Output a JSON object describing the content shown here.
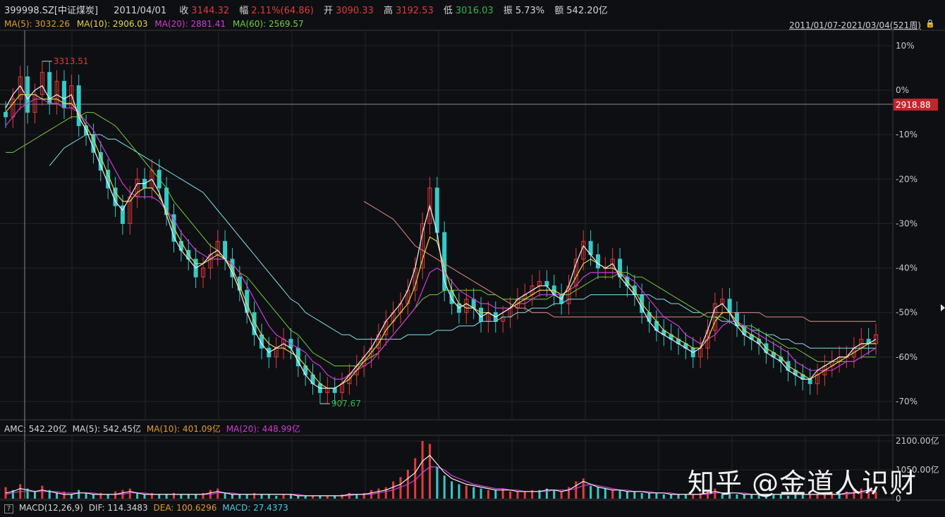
{
  "header": {
    "code": "399998.SZ[中证煤炭]",
    "date": "2011/04/01",
    "close_label": "收",
    "close": "3144.32",
    "change_label": "幅",
    "change": "2.11%(64.86)",
    "open_label": "开",
    "open": "3090.33",
    "high_label": "高",
    "high": "3192.53",
    "low_label": "低",
    "low": "3016.03",
    "amp_label": "振",
    "amp": "5.73%",
    "amount_label": "额",
    "amount": "542.20亿"
  },
  "ma_row": {
    "ma5": "MA(5): 3032.26",
    "ma10": "MA(10): 2906.03",
    "ma20": "MA(20): 2881.41",
    "ma60": "MA(60): 2569.57",
    "range": "2011/01/07-2021/03/04(521周)"
  },
  "amc_row": {
    "amc": "AMC: 542.20亿",
    "ma5": "MA(5): 542.45亿",
    "ma10": "MA(10): 401.09亿",
    "ma20": "MA(20): 448.99亿"
  },
  "macd_row": {
    "q": "?",
    "macd": "MACD(12,26,9)",
    "dif": "DIF: 114.3483",
    "dea": "DEA: 100.6296",
    "macdv": "MACD: 27.4373"
  },
  "watermark": "知乎 @金道人识财",
  "colors": {
    "up": "#e33b3b",
    "down": "#37c9c9",
    "ma5": "#f0f0f0",
    "ma10": "#e8d34a",
    "ma20": "#d23ad8",
    "ma60": "#6fcf3a",
    "ma120": "#7fe3ee",
    "ma250": "#e88a8a"
  },
  "chart_data": {
    "type": "line",
    "price_axis": {
      "ticks": [
        "10%",
        "0%",
        "-10%",
        "-20%",
        "-30%",
        "-40%",
        "-50%",
        "-60%",
        "-70%"
      ],
      "tick_values": [
        10,
        0,
        -10,
        -20,
        -30,
        -40,
        -50,
        -60,
        -70
      ],
      "current_label": "2918.88",
      "current_pct": -1.5,
      "high_label": "3313.51",
      "low_label": "907.67"
    },
    "volume_axis": {
      "ticks": [
        "2100.00亿",
        "1050.00亿",
        "0"
      ],
      "tick_values": [
        2100,
        1050,
        0
      ]
    },
    "close_pct": [
      -6,
      -2,
      3,
      -5,
      -1,
      4,
      -3,
      2,
      -4,
      1,
      -8,
      -10,
      -14,
      -18,
      -22,
      -26,
      -30,
      -24,
      -20,
      -22,
      -18,
      -22,
      -28,
      -34,
      -36,
      -38,
      -42,
      -40,
      -37,
      -34,
      -38,
      -42,
      -45,
      -50,
      -55,
      -58,
      -60,
      -58,
      -56,
      -58,
      -62,
      -64,
      -66,
      -68,
      -67,
      -68,
      -66,
      -64,
      -62,
      -60,
      -58,
      -55,
      -52,
      -50,
      -48,
      -45,
      -40,
      -30,
      -22,
      -32,
      -45,
      -48,
      -50,
      -47,
      -49,
      -52,
      -50,
      -52,
      -51,
      -49,
      -47,
      -46,
      -44,
      -43,
      -44,
      -46,
      -48,
      -44,
      -38,
      -34,
      -37,
      -40,
      -40,
      -38,
      -42,
      -44,
      -46,
      -50,
      -52,
      -54,
      -55,
      -56,
      -57,
      -58,
      -60,
      -58,
      -54,
      -48,
      -47,
      -50,
      -53,
      -55,
      -56,
      -57,
      -59,
      -60,
      -61,
      -63,
      -64,
      -65,
      -66,
      -64,
      -62,
      -61,
      -60,
      -60,
      -58,
      -56,
      -57,
      -55
    ],
    "series_pct": {
      "ma5": [
        -4,
        -1,
        1,
        -2,
        0,
        1,
        -2,
        -1,
        -2,
        -1,
        -6,
        -9,
        -13,
        -17,
        -21,
        -25,
        -27,
        -24,
        -21,
        -21,
        -20,
        -23,
        -28,
        -33,
        -36,
        -38,
        -40,
        -39,
        -37,
        -36,
        -38,
        -41,
        -45,
        -50,
        -54,
        -57,
        -59,
        -58,
        -57,
        -58,
        -61,
        -64,
        -66,
        -67,
        -67,
        -67,
        -66,
        -64,
        -62,
        -60,
        -58,
        -55,
        -52,
        -50,
        -48,
        -45,
        -40,
        -32,
        -26,
        -32,
        -43,
        -47,
        -49,
        -48,
        -49,
        -51,
        -50,
        -51,
        -50,
        -49,
        -47,
        -46,
        -45,
        -44,
        -44,
        -46,
        -47,
        -44,
        -39,
        -35,
        -37,
        -39,
        -40,
        -39,
        -42,
        -44,
        -46,
        -49,
        -52,
        -54,
        -55,
        -56,
        -57,
        -58,
        -59,
        -58,
        -54,
        -49,
        -48,
        -50,
        -53,
        -55,
        -56,
        -57,
        -59,
        -60,
        -61,
        -63,
        -64,
        -65,
        -65,
        -63,
        -62,
        -61,
        -60,
        -60,
        -58,
        -57,
        -57,
        -56
      ],
      "ma10": [
        -5,
        -3,
        -1,
        -1,
        -1,
        -2,
        -2,
        -2,
        -3,
        -3,
        -5,
        -8,
        -11,
        -15,
        -19,
        -23,
        -25,
        -25,
        -23,
        -22,
        -22,
        -24,
        -27,
        -31,
        -34,
        -37,
        -39,
        -39,
        -38,
        -37,
        -38,
        -40,
        -44,
        -48,
        -52,
        -55,
        -57,
        -58,
        -58,
        -59,
        -60,
        -62,
        -64,
        -66,
        -67,
        -67,
        -66,
        -65,
        -63,
        -61,
        -59,
        -57,
        -54,
        -52,
        -50,
        -48,
        -44,
        -38,
        -33,
        -34,
        -40,
        -45,
        -48,
        -49,
        -49,
        -50,
        -50,
        -51,
        -50,
        -49,
        -48,
        -47,
        -46,
        -45,
        -45,
        -45,
        -46,
        -45,
        -42,
        -39,
        -38,
        -39,
        -40,
        -40,
        -41,
        -43,
        -45,
        -48,
        -50,
        -52,
        -54,
        -55,
        -56,
        -57,
        -58,
        -58,
        -56,
        -52,
        -50,
        -50,
        -52,
        -54,
        -55,
        -56,
        -58,
        -59,
        -60,
        -62,
        -63,
        -64,
        -65,
        -64,
        -63,
        -62,
        -61,
        -60,
        -59,
        -58,
        -57,
        -57
      ],
      "ma20": [
        -8,
        -6,
        -4,
        -3,
        -2,
        -2,
        -3,
        -3,
        -4,
        -4,
        -5,
        -7,
        -9,
        -12,
        -15,
        -18,
        -21,
        -23,
        -24,
        -24,
        -24,
        -25,
        -27,
        -29,
        -32,
        -34,
        -36,
        -37,
        -38,
        -38,
        -38,
        -39,
        -41,
        -44,
        -47,
        -50,
        -53,
        -55,
        -56,
        -57,
        -58,
        -59,
        -61,
        -62,
        -64,
        -65,
        -65,
        -64,
        -63,
        -62,
        -61,
        -59,
        -57,
        -55,
        -53,
        -51,
        -49,
        -45,
        -41,
        -40,
        -41,
        -43,
        -45,
        -46,
        -47,
        -48,
        -48,
        -49,
        -49,
        -49,
        -48,
        -48,
        -47,
        -46,
        -46,
        -46,
        -46,
        -45,
        -44,
        -42,
        -41,
        -41,
        -41,
        -41,
        -41,
        -42,
        -43,
        -45,
        -47,
        -49,
        -51,
        -52,
        -53,
        -55,
        -56,
        -57,
        -56,
        -55,
        -53,
        -52,
        -52,
        -53,
        -54,
        -55,
        -56,
        -57,
        -58,
        -59,
        -61,
        -62,
        -63,
        -63,
        -63,
        -63,
        -62,
        -61,
        -61,
        -60,
        -59,
        -58
      ],
      "ma60": [
        -14,
        -14,
        -13,
        -12,
        -11,
        -10,
        -9,
        -8,
        -7,
        -6,
        -6,
        -5,
        -5,
        -6,
        -7,
        -8,
        -10,
        -12,
        -14,
        -16,
        -18,
        -20,
        -22,
        -25,
        -27,
        -29,
        -31,
        -33,
        -35,
        -36,
        -38,
        -39,
        -41,
        -42,
        -44,
        -46,
        -48,
        -50,
        -52,
        -54,
        -55,
        -57,
        -59,
        -60,
        -61,
        -62,
        -62,
        -62,
        -62,
        -61,
        -60,
        -59,
        -57,
        -55,
        -53,
        -51,
        -49,
        -47,
        -46,
        -46,
        -45,
        -45,
        -45,
        -45,
        -45,
        -45,
        -46,
        -46,
        -47,
        -47,
        -47,
        -47,
        -47,
        -47,
        -47,
        -46,
        -46,
        -46,
        -45,
        -44,
        -43,
        -42,
        -42,
        -42,
        -41,
        -41,
        -42,
        -42,
        -43,
        -44,
        -45,
        -46,
        -47,
        -48,
        -49,
        -50,
        -51,
        -51,
        -51,
        -52,
        -52,
        -53,
        -53,
        -54,
        -55,
        -56,
        -57,
        -58,
        -58,
        -59,
        -60,
        -61,
        -61,
        -61,
        -61,
        -61,
        -61,
        -60,
        -60,
        -60
      ],
      "ma120": [
        null,
        null,
        null,
        null,
        null,
        null,
        -17,
        -15,
        -13,
        -12,
        -11,
        -10,
        -10,
        -10,
        -11,
        -11,
        -12,
        -13,
        -14,
        -15,
        -16,
        -17,
        -18,
        -19,
        -20,
        -21,
        -22,
        -23,
        -25,
        -27,
        -29,
        -31,
        -33,
        -35,
        -37,
        -39,
        -41,
        -43,
        -45,
        -47,
        -48,
        -50,
        -51,
        -52,
        -53,
        -54,
        -55,
        -55,
        -56,
        -56,
        -56,
        -56,
        -56,
        -56,
        -56,
        -55,
        -55,
        -55,
        -55,
        -54,
        -54,
        -54,
        -53,
        -53,
        -53,
        -52,
        -52,
        -52,
        -51,
        -51,
        -50,
        -50,
        -49,
        -49,
        -49,
        -48,
        -48,
        -47,
        -47,
        -47,
        -46,
        -46,
        -46,
        -46,
        -46,
        -46,
        -46,
        -46,
        -46,
        -47,
        -47,
        -48,
        -48,
        -49,
        -50,
        -50,
        -51,
        -51,
        -52,
        -52,
        -53,
        -53,
        -54,
        -54,
        -55,
        -55,
        -56,
        -56,
        -57,
        -57,
        -58,
        -58,
        -58,
        -58,
        -58,
        -58,
        -58,
        -58,
        -58,
        -58
      ],
      "ma250": [
        null,
        null,
        null,
        null,
        null,
        null,
        null,
        null,
        null,
        null,
        null,
        null,
        null,
        null,
        null,
        null,
        null,
        null,
        null,
        null,
        null,
        null,
        null,
        null,
        null,
        null,
        null,
        null,
        null,
        null,
        null,
        null,
        null,
        null,
        null,
        null,
        null,
        null,
        null,
        null,
        null,
        null,
        null,
        null,
        null,
        null,
        null,
        null,
        null,
        -25,
        -26,
        -27,
        -28,
        -29,
        -31,
        -33,
        -35,
        -36,
        -37,
        -38,
        -39,
        -40,
        -41,
        -42,
        -43,
        -44,
        -45,
        -46,
        -47,
        -48,
        -49,
        -49,
        -50,
        -50,
        -50,
        -51,
        -51,
        -51,
        -51,
        -51,
        -51,
        -51,
        -51,
        -51,
        -51,
        -51,
        -51,
        -51,
        -51,
        -51,
        -51,
        -51,
        -51,
        -51,
        -51,
        -51,
        -50,
        -50,
        -50,
        -50,
        -50,
        -50,
        -50,
        -50,
        -51,
        -51,
        -51,
        -51,
        -51,
        -51,
        -52,
        -52,
        -52,
        -52,
        -52,
        -52,
        -52,
        -52,
        -52,
        -52
      ],
      "vol_ma5": [
        4,
        5,
        7,
        6,
        5,
        6,
        5,
        4,
        3,
        3,
        4,
        4,
        3,
        3,
        3,
        3,
        4,
        5,
        4,
        3,
        3,
        3,
        3,
        3,
        3,
        3,
        3,
        3,
        4,
        5,
        4,
        3,
        3,
        3,
        3,
        3,
        3,
        3,
        3,
        3,
        2,
        2,
        2,
        2,
        2,
        2,
        2,
        3,
        3,
        3,
        4,
        5,
        6,
        8,
        10,
        14,
        18,
        26,
        30,
        24,
        18,
        14,
        12,
        10,
        9,
        8,
        7,
        6,
        6,
        6,
        5,
        5,
        5,
        5,
        6,
        6,
        5,
        6,
        9,
        12,
        10,
        8,
        7,
        6,
        6,
        5,
        5,
        5,
        4,
        4,
        4,
        3,
        3,
        3,
        3,
        3,
        4,
        5,
        4,
        4,
        4,
        3,
        3,
        3,
        3,
        3,
        3,
        3,
        3,
        3,
        3,
        3,
        3,
        3,
        3,
        4,
        4,
        5,
        6,
        5
      ],
      "vol_ma10": [
        3,
        4,
        5,
        5,
        5,
        5,
        5,
        5,
        4,
        4,
        4,
        4,
        4,
        3,
        3,
        3,
        3,
        4,
        4,
        4,
        3,
        3,
        3,
        3,
        3,
        3,
        3,
        3,
        3,
        4,
        4,
        4,
        3,
        3,
        3,
        3,
        3,
        3,
        3,
        3,
        3,
        2,
        2,
        2,
        2,
        2,
        2,
        2,
        3,
        3,
        3,
        4,
        5,
        6,
        8,
        10,
        13,
        18,
        22,
        22,
        20,
        16,
        14,
        12,
        10,
        9,
        8,
        7,
        7,
        6,
        6,
        5,
        5,
        5,
        5,
        6,
        6,
        6,
        7,
        9,
        10,
        9,
        8,
        7,
        6,
        6,
        5,
        5,
        5,
        4,
        4,
        4,
        3,
        3,
        3,
        3,
        3,
        4,
        4,
        4,
        4,
        4,
        3,
        3,
        3,
        3,
        3,
        3,
        3,
        3,
        3,
        3,
        3,
        3,
        3,
        3,
        4,
        4,
        5,
        5
      ]
    },
    "volume": [
      8,
      6,
      10,
      7,
      5,
      9,
      6,
      4,
      5,
      3,
      6,
      4,
      3,
      4,
      3,
      5,
      6,
      7,
      4,
      3,
      4,
      3,
      3,
      4,
      3,
      3,
      3,
      4,
      6,
      7,
      4,
      3,
      3,
      3,
      4,
      3,
      3,
      2,
      3,
      3,
      2,
      2,
      2,
      2,
      2,
      2,
      3,
      4,
      3,
      4,
      6,
      7,
      8,
      12,
      15,
      20,
      28,
      40,
      38,
      22,
      16,
      12,
      10,
      9,
      8,
      7,
      6,
      6,
      7,
      5,
      5,
      5,
      6,
      6,
      7,
      6,
      5,
      8,
      12,
      14,
      9,
      8,
      7,
      6,
      6,
      5,
      5,
      4,
      4,
      4,
      3,
      3,
      3,
      3,
      3,
      4,
      6,
      7,
      4,
      4,
      3,
      3,
      3,
      3,
      3,
      3,
      3,
      2,
      3,
      3,
      3,
      3,
      4,
      4,
      4,
      5,
      6,
      7,
      8,
      5
    ],
    "volume_up": [
      1,
      0,
      1,
      0,
      0,
      1,
      0,
      0,
      1,
      0,
      0,
      0,
      0,
      1,
      0,
      1,
      1,
      1,
      0,
      0,
      1,
      0,
      0,
      1,
      0,
      0,
      0,
      1,
      1,
      1,
      0,
      0,
      0,
      0,
      1,
      0,
      0,
      0,
      1,
      0,
      0,
      0,
      1,
      0,
      1,
      0,
      1,
      1,
      0,
      1,
      1,
      1,
      1,
      1,
      1,
      1,
      1,
      1,
      1,
      0,
      0,
      0,
      0,
      1,
      0,
      0,
      1,
      0,
      1,
      1,
      1,
      1,
      1,
      0,
      0,
      0,
      1,
      1,
      1,
      1,
      0,
      0,
      0,
      1,
      0,
      0,
      0,
      0,
      0,
      0,
      0,
      0,
      0,
      0,
      1,
      1,
      1,
      1,
      0,
      0,
      0,
      0,
      0,
      0,
      0,
      0,
      0,
      0,
      0,
      0,
      1,
      1,
      1,
      1,
      0,
      1,
      1,
      1,
      1,
      1
    ]
  }
}
